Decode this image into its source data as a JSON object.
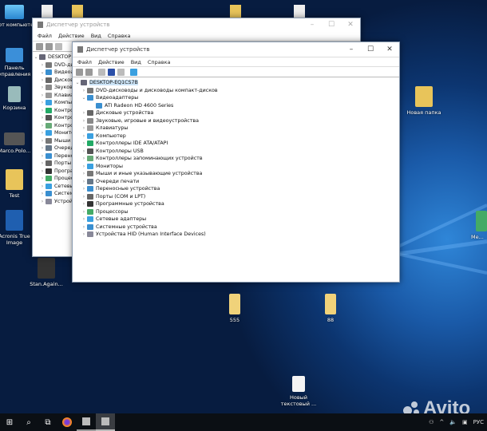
{
  "desktop": {
    "icons": [
      {
        "label": "Этот компьютер",
        "icon": "computer-icon"
      },
      {
        "label": "Панель управления",
        "icon": "control-panel-icon"
      },
      {
        "label": "Корзина",
        "icon": "recycle-bin-icon"
      },
      {
        "label": "Marco.Polo...",
        "icon": "video-file-icon"
      },
      {
        "label": "Test",
        "icon": "folder-icon"
      },
      {
        "label": "Acronis True Image",
        "icon": "acronis-icon"
      },
      {
        "label": "Stan.Again...",
        "icon": "video-file-icon"
      },
      {
        "label": "Новая папка",
        "icon": "folder-icon"
      },
      {
        "label": "555",
        "icon": "folder-icon"
      },
      {
        "label": "88",
        "icon": "folder-icon"
      },
      {
        "label": "Новый текстовый ...",
        "icon": "text-file-icon"
      },
      {
        "label": "Me...",
        "icon": "app-icon"
      }
    ]
  },
  "back_window": {
    "title": "Диспетчер устройств",
    "root": "DESKTOP"
  },
  "window": {
    "title": "Диспетчер устройств",
    "menu": [
      "Файл",
      "Действие",
      "Вид",
      "Справка"
    ],
    "root": "DESKTOP-EQ1CS7B",
    "tree": [
      {
        "label": "DVD-дисководы и дисководы компакт-дисков",
        "expanded": false,
        "color": "#777"
      },
      {
        "label": "Видеоадаптеры",
        "expanded": true,
        "color": "#3a8fd0",
        "children": [
          "ATI Radeon HD 4600 Series"
        ]
      },
      {
        "label": "Дисковые устройства",
        "expanded": false,
        "color": "#666"
      },
      {
        "label": "Звуковые, игровые и видеоустройства",
        "expanded": false,
        "color": "#888"
      },
      {
        "label": "Клавиатуры",
        "expanded": false,
        "color": "#999"
      },
      {
        "label": "Компьютер",
        "expanded": false,
        "color": "#3aa0e0"
      },
      {
        "label": "Контроллеры IDE ATA/ATAPI",
        "expanded": false,
        "color": "#2a6"
      },
      {
        "label": "Контроллеры USB",
        "expanded": false,
        "color": "#555"
      },
      {
        "label": "Контроллеры запоминающих устройств",
        "expanded": false,
        "color": "#6a7"
      },
      {
        "label": "Мониторы",
        "expanded": false,
        "color": "#3aa0e0"
      },
      {
        "label": "Мыши и иные указывающие устройства",
        "expanded": false,
        "color": "#777"
      },
      {
        "label": "Очереди печати",
        "expanded": false,
        "color": "#678"
      },
      {
        "label": "Переносные устройства",
        "expanded": false,
        "color": "#3a8fd0"
      },
      {
        "label": "Порты (COM и LPT)",
        "expanded": false,
        "color": "#666"
      },
      {
        "label": "Программные устройства",
        "expanded": false,
        "color": "#333"
      },
      {
        "label": "Процессоры",
        "expanded": false,
        "color": "#4a6"
      },
      {
        "label": "Сетевые адаптеры",
        "expanded": false,
        "color": "#3aa0e0"
      },
      {
        "label": "Системные устройства",
        "expanded": false,
        "color": "#3a8fd0"
      },
      {
        "label": "Устройства HID (Human Interface Devices)",
        "expanded": false,
        "color": "#889"
      }
    ]
  },
  "taskbar": {
    "tray_lang": "РУС",
    "watermark": "Avito"
  }
}
